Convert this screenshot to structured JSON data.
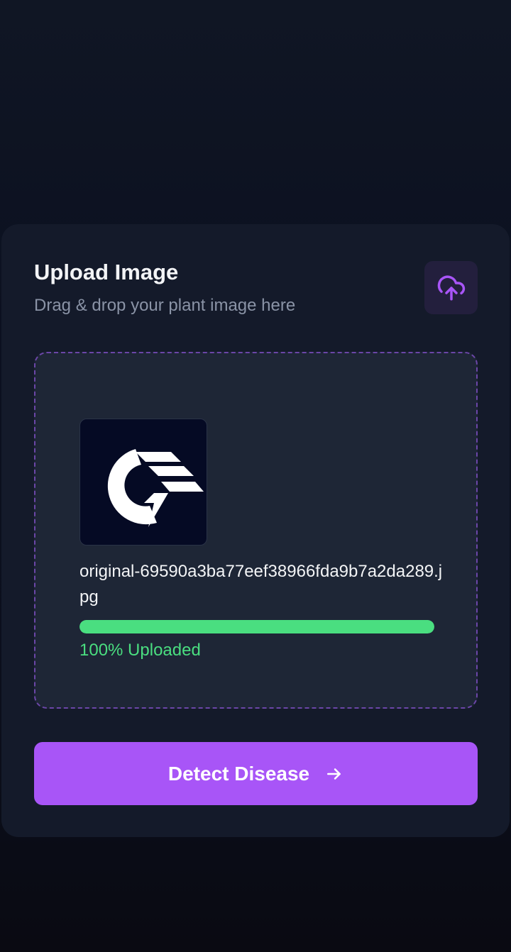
{
  "upload_card": {
    "title": "Upload Image",
    "subtitle": "Drag & drop your plant image here",
    "upload_icon": "cloud-upload-icon"
  },
  "dropzone": {
    "file_name": "original-69590a3ba77eef38966fda9b7a2da289.jpg",
    "progress_fraction": 1.0,
    "progress_text": "100% Uploaded",
    "thumbnail_icon": "logo-thumbnail"
  },
  "actions": {
    "detect_label": "Detect Disease",
    "detect_icon": "arrow-right-icon"
  },
  "colors": {
    "accent": "#a855f7",
    "success": "#4ade80",
    "card_bg": "#141a2a",
    "dropzone_border": "#6b46a8"
  }
}
